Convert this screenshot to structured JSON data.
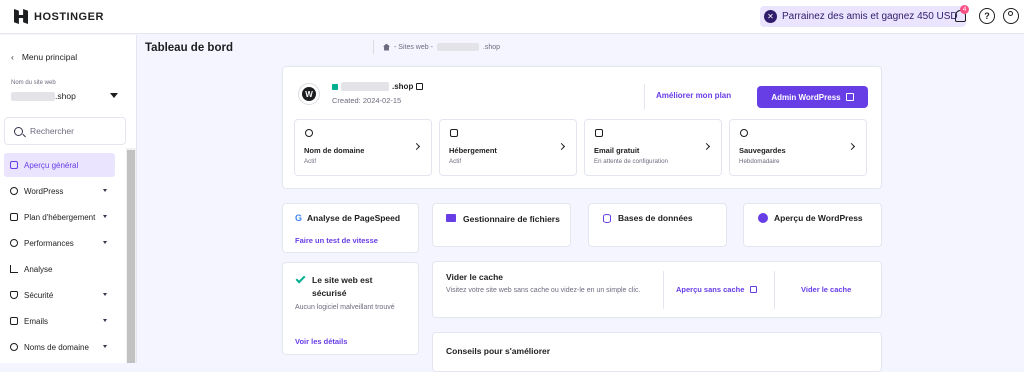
{
  "topbar": {
    "logo_text": "HOSTINGER",
    "referral_text": "Parrainez des amis et gagnez 450 USD",
    "notification_count": "4"
  },
  "sidebar": {
    "back_label": "Menu principal",
    "site_label": "Nom du site web",
    "site_suffix": ".shop",
    "search_placeholder": "Rechercher",
    "items": [
      {
        "label": "Aperçu général",
        "active": true
      },
      {
        "label": "WordPress"
      },
      {
        "label": "Plan d'hébergement"
      },
      {
        "label": "Performances"
      },
      {
        "label": "Analyse"
      },
      {
        "label": "Sécurité"
      },
      {
        "label": "Emails"
      },
      {
        "label": "Noms de domaine"
      }
    ]
  },
  "header": {
    "title": "Tableau de bord",
    "breadcrumb_sites": "- Sites web -",
    "breadcrumb_suffix": ".shop"
  },
  "site_card": {
    "domain_suffix": ".shop",
    "created": "Created: 2024-02-15",
    "upgrade_label": "Améliorer mon plan",
    "admin_label": "Admin WordPress",
    "tiles": [
      {
        "title": "Nom de domaine",
        "status": "Actif"
      },
      {
        "title": "Hébergement",
        "status": "Actif"
      },
      {
        "title": "Email gratuit",
        "status": "En attente de configuration"
      },
      {
        "title": "Sauvegardes",
        "status": "Hebdomadaire"
      }
    ]
  },
  "pagespeed": {
    "title": "Analyse de PageSpeed",
    "link": "Faire un test de vitesse"
  },
  "quick": {
    "files": "Gestionnaire de fichiers",
    "databases": "Bases de données",
    "wp_overview": "Aperçu de WordPress"
  },
  "security": {
    "title": "Le site web est sécurisé",
    "desc": "Aucun logiciel malveillant trouvé",
    "link": "Voir les détails"
  },
  "cache": {
    "title": "Vider le cache",
    "desc": "Visitez votre site web sans cache ou videz-le en un simple clic.",
    "preview_label": "Aperçu sans cache",
    "clear_label": "Vider le cache"
  },
  "tips": {
    "title": "Conseils pour s'améliorer"
  }
}
